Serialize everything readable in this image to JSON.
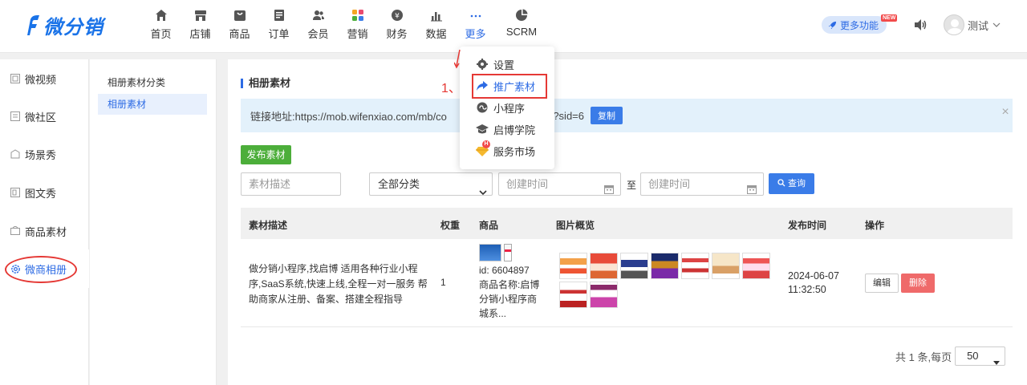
{
  "brand": {
    "logo_text": "微分销",
    "accent": "#2d6be4"
  },
  "nav": {
    "items": [
      {
        "label": "首页",
        "icon": "home-icon"
      },
      {
        "label": "店铺",
        "icon": "store-icon"
      },
      {
        "label": "商品",
        "icon": "goods-icon"
      },
      {
        "label": "订单",
        "icon": "order-icon"
      },
      {
        "label": "会员",
        "icon": "member-icon"
      },
      {
        "label": "营销",
        "icon": "marketing-icon"
      },
      {
        "label": "财务",
        "icon": "finance-icon"
      },
      {
        "label": "数据",
        "icon": "data-icon"
      },
      {
        "label": "更多",
        "icon": "more-dots-icon"
      },
      {
        "label": "SCRM",
        "icon": "scrm-pie-icon"
      }
    ],
    "active": "更多"
  },
  "header": {
    "more_features": "更多功能",
    "new_tag": "NEW",
    "user_name": "测试"
  },
  "dropdown": {
    "items": [
      {
        "label": "设置",
        "icon": "gear-icon"
      },
      {
        "label": "推广素材",
        "icon": "share-arrow-icon"
      },
      {
        "label": "小程序",
        "icon": "mini-program-icon"
      },
      {
        "label": "启博学院",
        "icon": "graduation-cap-icon"
      },
      {
        "label": "服务市场",
        "icon": "diamond-icon"
      }
    ],
    "badge": "H",
    "annotation": "1、"
  },
  "sidebar": {
    "items": [
      {
        "label": "微视频",
        "icon": "video-icon"
      },
      {
        "label": "微社区",
        "icon": "community-icon"
      },
      {
        "label": "场景秀",
        "icon": "scene-icon"
      },
      {
        "label": "图文秀",
        "icon": "article-icon"
      },
      {
        "label": "商品素材",
        "icon": "material-icon"
      },
      {
        "label": "微商相册",
        "icon": "album-gear-icon"
      }
    ],
    "active": "微商相册"
  },
  "subnav": {
    "title": "相册素材分类",
    "item": "相册素材"
  },
  "main": {
    "section_title": "相册素材",
    "link_label": "链接地址:https://mob.wifenxiao.com/mb/co",
    "link_tail": "nter?sid=6",
    "copy_label": "复制",
    "publish_label": "发布素材",
    "filters": {
      "desc_placeholder": "素材描述",
      "category": "全部分类",
      "start_placeholder": "创建时间",
      "to_label": "至",
      "end_placeholder": "创建时间",
      "query_label": "查询"
    },
    "table": {
      "headers": [
        "素材描述",
        "权重",
        "商品",
        "图片概览",
        "发布时间",
        "操作"
      ],
      "rows": [
        {
          "desc": "做分销小程序,找启博 适用各种行业小程序,SaaS系统,快速上线,全程一对一服务 帮助商家从注册、备案、搭建全程指导",
          "weight": "1",
          "goods_id": "id: 6604897",
          "goods_name": "商品名称:启博分销小程序商城系...",
          "time_date": "2024-06-07",
          "time_clock": "11:32:50",
          "edit_label": "编辑",
          "delete_label": "删除"
        }
      ]
    },
    "pager": {
      "summary": "共 1 条,每页",
      "page_size": "50"
    }
  }
}
